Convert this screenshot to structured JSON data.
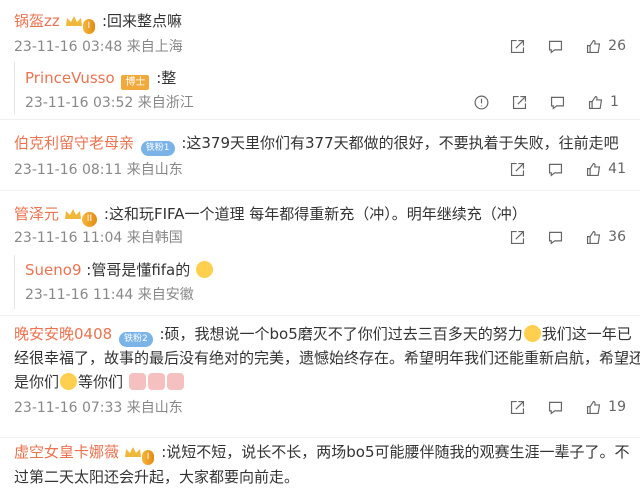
{
  "comments": [
    {
      "user": "锅盔zz",
      "badge": "I",
      "text": ":回来整点嘛",
      "time": "23-11-16 03:48",
      "loc": "来自上海",
      "likes": "26",
      "reply": {
        "user": "PrinceVusso",
        "badge": "博士",
        "text": ":整",
        "time": "23-11-16 03:52",
        "loc": "来自浙江",
        "likes": "1"
      }
    },
    {
      "user": "伯克利留守老母亲",
      "badge": "铁粉1",
      "text": ":这379天里你们有377天都做的很好，不要执着于失败，往前走吧",
      "time": "23-11-16 08:11",
      "loc": "来自山东",
      "likes": "41"
    },
    {
      "user": "管泽元",
      "badge": "II",
      "text": ":这和玩FIFA一个道理 每年都得重新充（冲）。明年继续充（冲）",
      "time": "23-11-16 11:04",
      "loc": "来自韩国",
      "likes": "36",
      "reply": {
        "user": "Sueno9",
        "text": ":管哥是懂fifa的",
        "time": "23-11-16 11:44",
        "loc": "来自安徽"
      }
    },
    {
      "user": "晚安安晚0408",
      "badge": "铁粉2",
      "text1": ":硕，我想说一个bo5磨灭不了你们过去三百多天的努力",
      "text1b": "我们这一年已",
      "text2": "经很幸福了，故事的最后没有绝对的完美，遗憾始终存在。希望明年我们还能重新启航，希望还",
      "text3a": "是你们",
      "text3b": "等你们",
      "time": "23-11-16 07:33",
      "loc": "来自山东",
      "likes": "19"
    },
    {
      "user": "虚空女皇卡娜薇",
      "badge": "I",
      "text1": ":说短不短，说长不长，两场bo5可能腰伴随我的观赛生涯一辈子了。不",
      "text2": "过第二天太阳还会升起，大家都要向前走。"
    }
  ]
}
